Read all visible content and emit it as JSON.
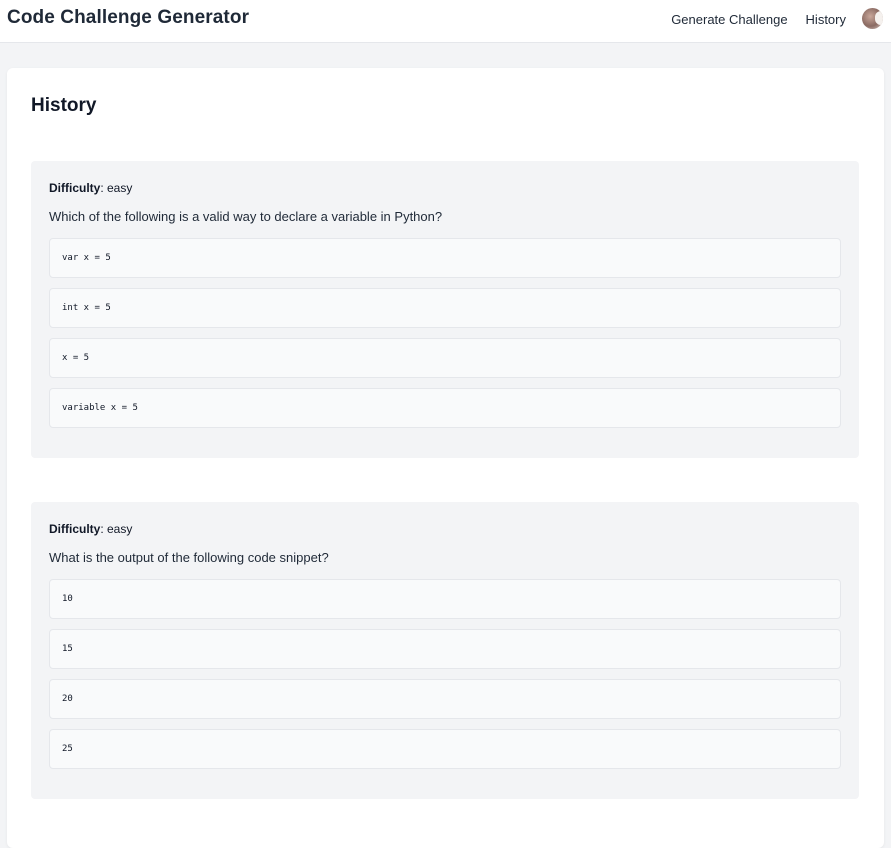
{
  "header": {
    "title": "Code Challenge Generator",
    "nav": [
      {
        "label": "Generate Challenge"
      },
      {
        "label": "History"
      }
    ]
  },
  "page": {
    "title": "History"
  },
  "difficulty_label": "Difficulty",
  "challenges": [
    {
      "difficulty": ": easy",
      "question": "Which of the following is a valid way to declare a variable in Python?",
      "options": [
        "var x = 5",
        "int x = 5",
        "x = 5",
        "variable x = 5"
      ]
    },
    {
      "difficulty": ": easy",
      "question": "What is the output of the following code snippet?",
      "options": [
        "10",
        "15",
        "20",
        "25"
      ]
    }
  ]
}
